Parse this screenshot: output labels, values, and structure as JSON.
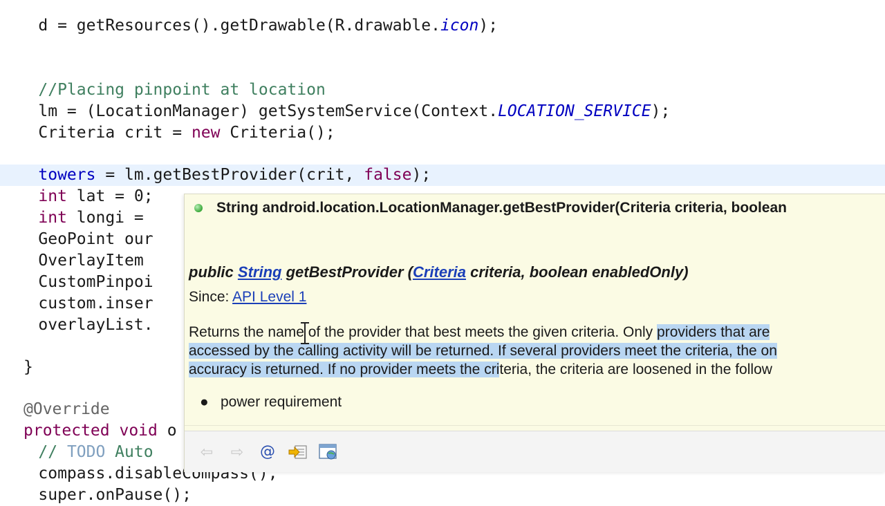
{
  "code": {
    "l1": {
      "a": "    d = getResources().getDrawable(R.drawable.",
      "b": "icon",
      "c": ");"
    },
    "comment": "    //Placing pinpoint at location",
    "l3": {
      "a": "    lm = (LocationManager) getSystemService(Context.",
      "b": "LOCATION_SERVICE",
      "c": ");"
    },
    "l4": {
      "a": "    Criteria crit = ",
      "kw": "new",
      "b": " Criteria();"
    },
    "l5": {
      "a": "    ",
      "field": "towers",
      "b": " = lm.getBestProvider(crit, ",
      "kw": "false",
      "c": ");"
    },
    "l6": {
      "kw": "    int",
      "b": " lat = 0;"
    },
    "l7": {
      "kw": "    int",
      "b": " longi = "
    },
    "l8": "    GeoPoint our",
    "l9": "    OverlayItem ",
    "l10": "    CustomPinpoi",
    "l11": "    custom.inser",
    "l12": "    overlayList.",
    "l13": "}",
    "l14": "@Override",
    "l15": {
      "kw": "protected void",
      "b": " o"
    },
    "l16": {
      "cm": "    // ",
      "todo": "TODO",
      "cm2": " Auto"
    },
    "l17": "    compass.disableCompass();",
    "l18": "    super.onPause();"
  },
  "popup": {
    "header_signature": "String android.location.LocationManager.getBestProvider(Criteria criteria, boolean",
    "doc_signature": {
      "prefix": "public ",
      "return_type": "String",
      "mid": " getBestProvider (",
      "param_type": "Criteria",
      "suffix": " criteria, boolean enabledOnly)"
    },
    "since_label": "Since: ",
    "since_link": "API Level 1",
    "description": {
      "line1_plain": "Returns the name of the provider that best meets the given criteria. Only ",
      "line1_hl": "providers that are",
      "line2_hl": "accessed by the calling activity will be returned. If several providers meet the criteria, the on",
      "line3_hl": "accuracy is returned. If no provider meets the cri",
      "line3_plain": "teria, the criteria are loosened in the follow"
    },
    "bullets": [
      "power requirement"
    ],
    "toolbar": {
      "back_icon": "back-arrow-icon",
      "forward_icon": "forward-arrow-icon",
      "at_glyph": "@",
      "source_icon": "open-declaration-icon",
      "browser_icon": "open-in-browser-icon"
    }
  },
  "colors": {
    "popup_bg": "#fbfbe4",
    "highlight": "#b9d6f2",
    "keyword": "#7f0055",
    "comment": "#3f7f5f",
    "link": "#1b3fb8"
  }
}
